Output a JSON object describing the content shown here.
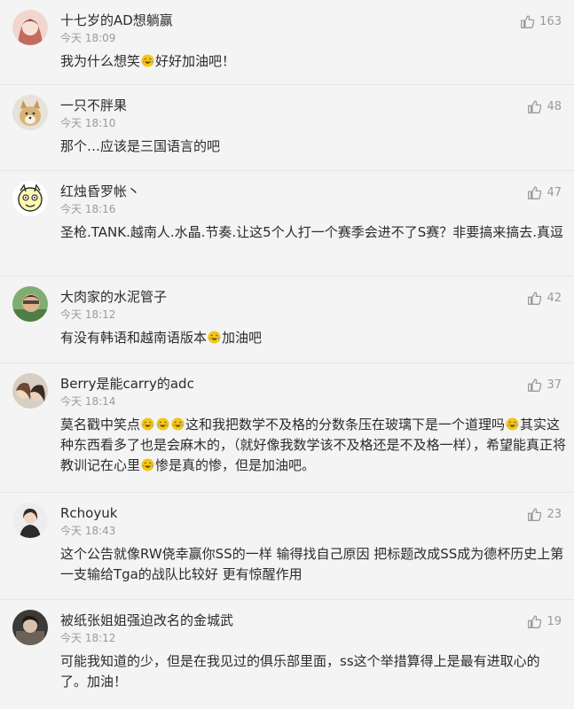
{
  "comments": [
    {
      "name": "十七岁的AD想躺赢",
      "time": "今天 18:09",
      "likes": "163",
      "text_parts": [
        "我为什么想笑",
        "好好加油吧！"
      ],
      "emoji_count": 1
    },
    {
      "name": "一只不胖果",
      "time": "今天 18:10",
      "likes": "48",
      "text_parts": [
        "那个…应该是三国语言的吧"
      ],
      "emoji_count": 0
    },
    {
      "name": "红烛昏罗帐丶",
      "time": "今天 18:16",
      "likes": "47",
      "text_parts": [
        "圣枪.TANK.越南人.水晶.节奏.让这5个人打一个赛季会进不了S赛？非要搞来搞去.真逗"
      ],
      "emoji_count": 0
    },
    {
      "name": "大肉家的水泥管子",
      "time": "今天 18:12",
      "likes": "42",
      "text_parts": [
        "有没有韩语和越南语版本",
        "加油吧"
      ],
      "emoji_count": 1
    },
    {
      "name": "Berry是能carry的adc",
      "time": "今天 18:14",
      "likes": "37",
      "text_parts": [
        "莫名戳中笑点",
        "这和我把数学不及格的分数条压在玻璃下是一个道理吗",
        "其实这种东西看多了也是会麻木的，（就好像我数学该不及格还是不及格一样），希望能真正将教训记在心里",
        "惨是真的惨，但是加油吧。"
      ],
      "emoji_count": 5
    },
    {
      "name": "Rchoyuk",
      "time": "今天 18:43",
      "likes": "23",
      "text_parts": [
        "这个公告就像RW侥幸赢你SS的一样 输得找自己原因 把标题改成SS成为德杯历史上第一支输给Tga的战队比较好 更有惊醒作用"
      ],
      "emoji_count": 0
    },
    {
      "name": "被纸张姐姐强迫改名的金城武",
      "time": "今天 18:12",
      "likes": "19",
      "text_parts": [
        "可能我知道的少，但是在我见过的俱乐部里面，ss这个举措算得上是最有进取心的了。加油！"
      ],
      "emoji_count": 0
    }
  ],
  "icons": {
    "like": "thumbs-up-icon",
    "emoji": "laughing-tears-emoji-icon"
  },
  "colors": {
    "background": "#f4f4f4",
    "text": "#2b2b2b",
    "muted": "#9a9a9a",
    "divider": "#e6e6e6",
    "emoji_face": "#f5c518"
  }
}
